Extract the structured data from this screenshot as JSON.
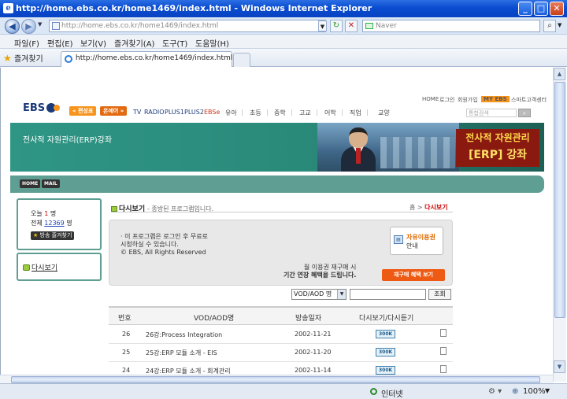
{
  "window": {
    "title": "http://home.ebs.co.kr/home1469/index.html - Windows Internet Explorer",
    "min": "_",
    "max": "□",
    "close": "✕"
  },
  "address": {
    "url": "http://home.ebs.co.kr/home1469/index.html",
    "search_placeholder": "Naver"
  },
  "menu": [
    "파일(F)",
    "편집(E)",
    "보기(V)",
    "즐겨찾기(A)",
    "도구(T)",
    "도움말(H)"
  ],
  "favorites": {
    "label": "즐겨찾기"
  },
  "tab": {
    "label": "http://home.ebs.co.kr/home1469/index.html"
  },
  "ebs": {
    "logo": "EBS",
    "top_links": [
      "HOME",
      "로그인",
      "회원가입",
      "MY EBS",
      "스마트고객센터"
    ],
    "pills": [
      "편성표",
      "온에어"
    ],
    "gnb_en": [
      "TV",
      "RADIO",
      "PLUS1",
      "PLUS2",
      "EBSe"
    ],
    "gnb_ko": [
      "유아",
      "초등",
      "중학",
      "고교",
      "어학",
      "직업",
      "교양"
    ],
    "site_search_placeholder": "통합검색"
  },
  "banner": {
    "title": "전사적 자원관리(ERP)강좌",
    "badge_line1": "전사적 자원관리",
    "badge_line2": "[ERP] 강좌"
  },
  "subnav": [
    "HOME",
    "MAIL"
  ],
  "sidebar": {
    "today_label": "오늘",
    "today_value": "1",
    "today_unit": "명",
    "total_label": "전체",
    "total_value": "12369",
    "total_unit": "명",
    "fav_label": "방송 즐겨찾기",
    "replay_label": "다시보기"
  },
  "page": {
    "title": "다시보기",
    "desc": "- 종방된 프로그램입니다.",
    "crumb_home": "홈",
    "crumb_sep": ">",
    "crumb_current": "다시보기"
  },
  "info": {
    "line1": "· 이 프로그램은 로그인 후 무료로",
    "line2": "  시청하실 수 있습니다.",
    "line3": "  © EBS, All Rights Reserved",
    "free_title": "자유이용권",
    "free_sub": "안내",
    "ext_line1": "월 이용권 재구매 시",
    "ext_line2": "기간 연장 혜택을 드립니다.",
    "benefit_btn": "재구매 혜택 보기"
  },
  "search": {
    "type": "VOD/AOD 명",
    "go": "조회"
  },
  "table": {
    "headers": [
      "번호",
      "VOD/AOD명",
      "방송일자",
      "다시보기/다시듣기"
    ],
    "rows": [
      {
        "no": "26",
        "title": "26강:Process Integration",
        "date": "2002-11-21",
        "badge": "300K"
      },
      {
        "no": "25",
        "title": "25강:ERP 모듈 소개 - EIS",
        "date": "2002-11-20",
        "badge": "300K"
      },
      {
        "no": "24",
        "title": "24강:ERP 모듈 소개 - 회계관리",
        "date": "2002-11-14",
        "badge": "300K"
      }
    ]
  },
  "status": {
    "zone": "인터넷",
    "zoom": "100%"
  },
  "colors": {
    "accent": "#5f9e92",
    "orange": "#ee5a14",
    "titlebar": "#0a4cd0"
  }
}
